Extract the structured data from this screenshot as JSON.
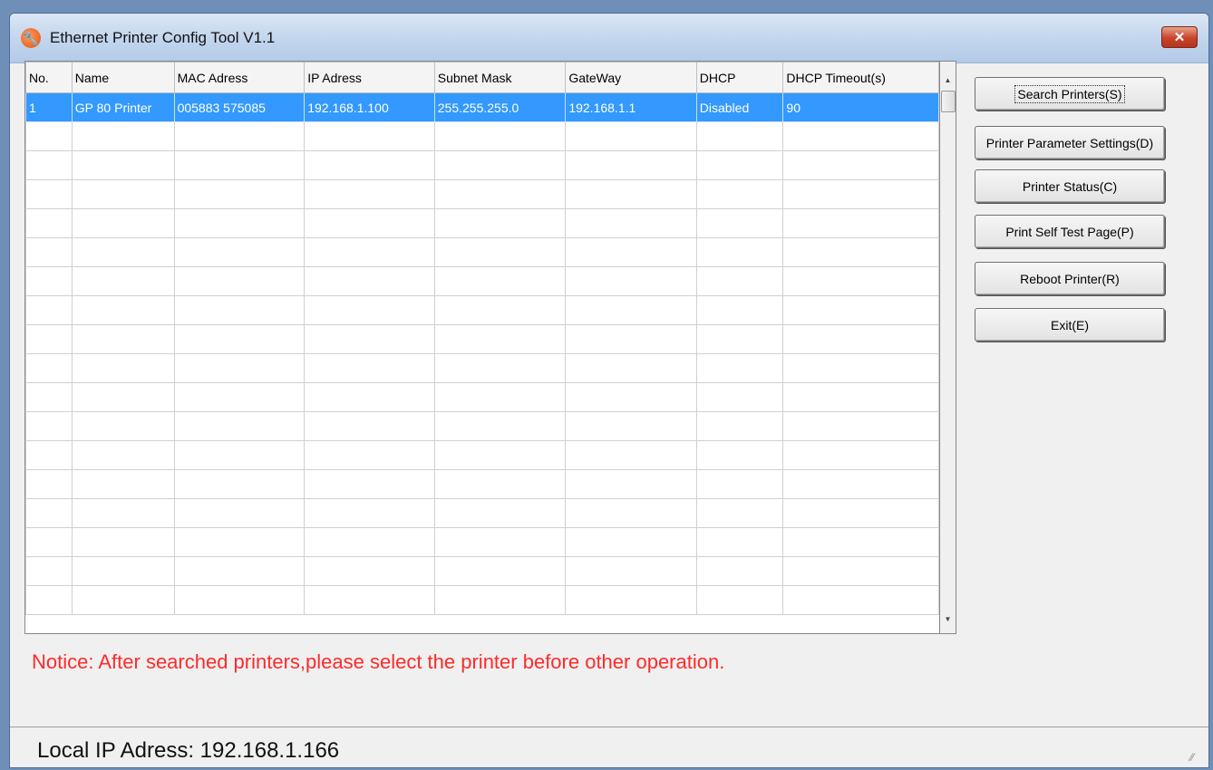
{
  "window": {
    "title": "Ethernet Printer Config Tool V1.1",
    "close_symbol": "✕"
  },
  "grid": {
    "columns": [
      "No.",
      "Name",
      "MAC Adress",
      "IP Adress",
      "Subnet Mask",
      "GateWay",
      "DHCP",
      "DHCP Timeout(s)"
    ],
    "rows": [
      [
        "1",
        "GP 80 Printer",
        "005883 575085",
        "192.168.1.100",
        "255.255.255.0",
        "192.168.1.1",
        "Disabled",
        "90"
      ]
    ],
    "empty_row_count": 17,
    "selected_row": 0
  },
  "scrollbar": {
    "up_symbol": "▲",
    "down_symbol": "▼"
  },
  "buttons": {
    "search": "Search Printers(S)",
    "settings": "Printer Parameter Settings(D)",
    "status": "Printer Status(C)",
    "selftest": "Print Self Test Page(P)",
    "reboot": "Reboot Printer(R)",
    "exit": "Exit(E)"
  },
  "notice": "Notice: After searched printers,please select the printer before other operation.",
  "status_bar": {
    "local_ip": "Local IP Adress:  192.168.1.166"
  },
  "colors": {
    "selection": "#3399ff",
    "notice": "#ff2a2a",
    "titlebar": "#c3d6ee"
  },
  "icons": {
    "app": "wrench-icon",
    "close": "close-icon",
    "grip": "resize-grip-icon"
  }
}
